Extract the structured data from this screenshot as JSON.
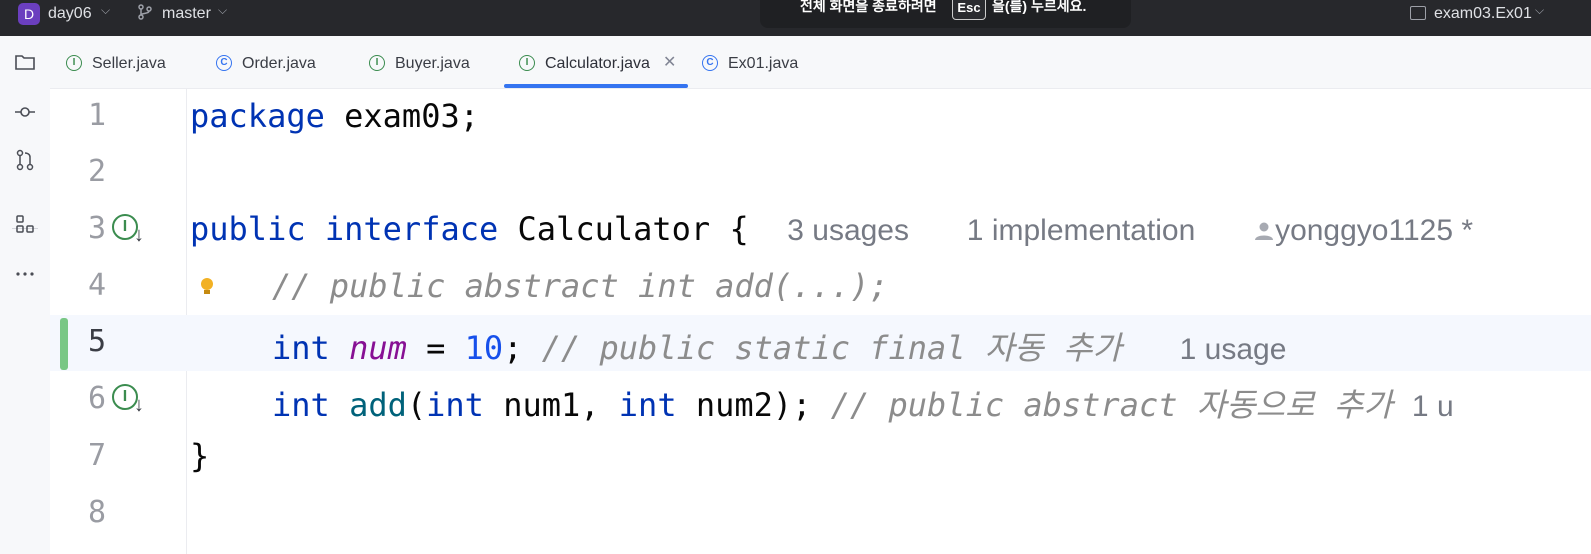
{
  "titlebar": {
    "project_badge": "D",
    "project_name": "day06",
    "branch_icon": "git-branch-icon",
    "branch_name": "master",
    "run_config": "exam03.Ex01",
    "fullscreen_hint_before": "전체 화면을 종료하려면",
    "fullscreen_hint_key": "Esc",
    "fullscreen_hint_after": "을(를) 누르세요."
  },
  "toolstrip": {
    "icons": [
      "folder-icon",
      "commit-icon",
      "pull-requests-icon",
      "structure-icon",
      "more-icon"
    ]
  },
  "tabs": [
    {
      "label": "Seller.java",
      "icon": "interface-icon",
      "icon_letter": "I",
      "active": false
    },
    {
      "label": "Order.java",
      "icon": "class-icon",
      "icon_letter": "C",
      "active": false
    },
    {
      "label": "Buyer.java",
      "icon": "interface-icon",
      "icon_letter": "I",
      "active": false
    },
    {
      "label": "Calculator.java",
      "icon": "interface-icon",
      "icon_letter": "I",
      "active": true
    },
    {
      "label": "Ex01.java",
      "icon": "runnable-class-icon",
      "icon_letter": "C",
      "active": false
    }
  ],
  "editor": {
    "line_numbers": [
      "1",
      "2",
      "3",
      "4",
      "5",
      "6",
      "7",
      "8"
    ],
    "current_line": "5",
    "line1": {
      "kw": "package",
      "rest": " exam03;"
    },
    "line3": {
      "kw1": "public",
      "kw2": "interface",
      "name": " Calculator {",
      "hint_usages": "3 usages",
      "hint_impl": "1 implementation",
      "hint_author": "yonggyo1125 *"
    },
    "line4": {
      "comment": "// public abstract int add(...);"
    },
    "line5": {
      "kw": "int",
      "field": "num",
      "eq": " = ",
      "number": "10",
      "semi": ";",
      "comment": " // public static final 자동 추가",
      "hint_usage": "1 usage"
    },
    "line6": {
      "kw": "int",
      "method": "add",
      "p_open": "(",
      "kw2": "int",
      "p1": " num1, ",
      "kw3": "int",
      "p2": " num2);",
      "comment": " // public abstract 자동으로 추가",
      "hint_usage": "1 u"
    },
    "line7": {
      "code": "}"
    },
    "gutter_impl_letter": "I",
    "gutter_arrow": "↓"
  },
  "colors": {
    "keyword": "#0033b3",
    "number": "#1750eb",
    "field": "#871094",
    "method": "#00627a",
    "comment": "#8c8c8c",
    "tab_active_underline": "#3574f0",
    "change_marker": "#79c785"
  }
}
